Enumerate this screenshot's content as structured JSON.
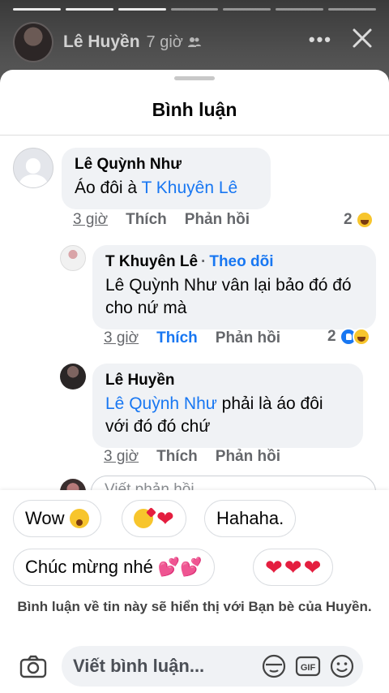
{
  "story": {
    "name": "Lê Huyền",
    "time": "7 giờ",
    "more_icon": "more-dots-icon",
    "close_icon": "close-icon"
  },
  "sheet": {
    "title": "Bình luận"
  },
  "comments": [
    {
      "author": "Lê Quỳnh Như",
      "text_prefix": "Áo đôi à ",
      "mention": "T Khuyên Lê",
      "time": "3 giờ",
      "like": "Thích",
      "reply": "Phản hồi",
      "reaction_count": "2"
    },
    {
      "author": "T Khuyên Lê",
      "follow": "Theo dõi",
      "text": "Lê Quỳnh Như vân  lại bảo đó đó cho nứ mà",
      "time": "3 giờ",
      "like": "Thích",
      "reply": "Phản hồi",
      "reaction_count": "2"
    },
    {
      "author": "Lê Huyền",
      "mention": "Lê Quỳnh Như",
      "text_suffix": " phải là áo đôi với đó đó chứ",
      "time": "3 giờ",
      "like": "Thích",
      "reply": "Phản hồi"
    }
  ],
  "reply_placeholder": "Viết phản hồi...",
  "quick_replies": {
    "wow": "Wow",
    "hahaha": "Hahaha.",
    "congrats": "Chúc mừng nhé"
  },
  "notice": "Bình luận về tin này sẽ hiển thị với  Bạn bè của Huyền.",
  "composer": {
    "placeholder": "Viết bình luận...",
    "gif_label": "GIF"
  }
}
